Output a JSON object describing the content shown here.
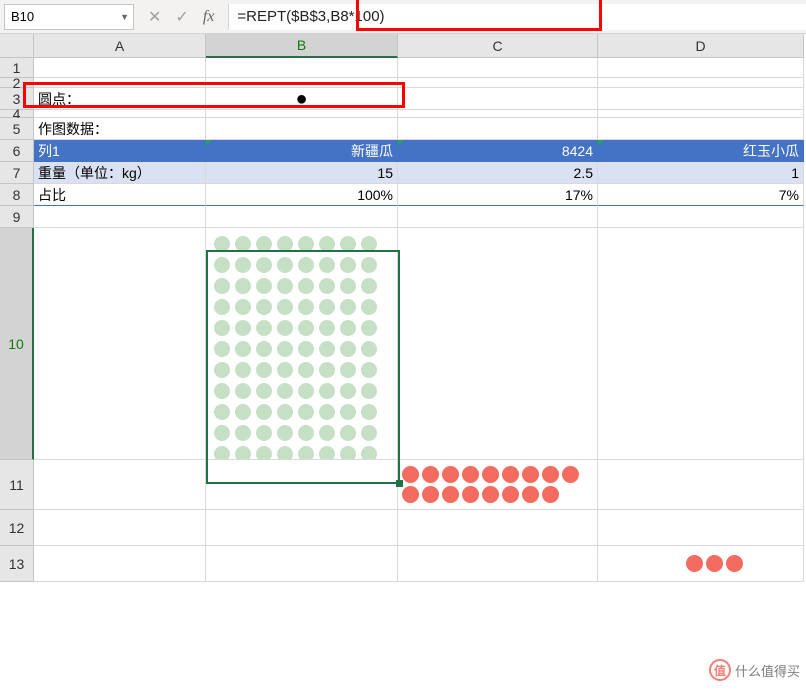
{
  "namebox": {
    "value": "B10"
  },
  "formula_bar": {
    "formula": "=REPT($B$3,B8*100)"
  },
  "columns": [
    "A",
    "B",
    "C",
    "D"
  ],
  "rows": [
    "1",
    "2",
    "3",
    "4",
    "5",
    "6",
    "7",
    "8",
    "9",
    "10",
    "11",
    "12",
    "13"
  ],
  "selected_cell": "B10",
  "cells": {
    "A3": "圆点：",
    "B3": "●",
    "A5": "作图数据：",
    "A6": "列1",
    "B6": "新疆瓜",
    "C6": "8424",
    "D6": "红玉小瓜",
    "A7": "重量（单位：kg）",
    "B7": "15",
    "C7": "2.5",
    "D7": "1",
    "A8": "占比",
    "B8": "100%",
    "C8": "17%",
    "D8": "7%"
  },
  "chart_data": {
    "type": "table",
    "title": "作图数据",
    "columns": [
      "列1",
      "新疆瓜",
      "8424",
      "红玉小瓜"
    ],
    "series": [
      {
        "name": "重量（单位：kg）",
        "values": [
          15,
          2.5,
          1
        ]
      },
      {
        "name": "占比",
        "values": [
          1.0,
          0.17,
          0.07
        ]
      }
    ],
    "dot_counts": {
      "B10": 100,
      "C11": 17,
      "D13_visible": 3
    }
  },
  "watermark": {
    "text": "什么值得买",
    "brand": "值"
  }
}
